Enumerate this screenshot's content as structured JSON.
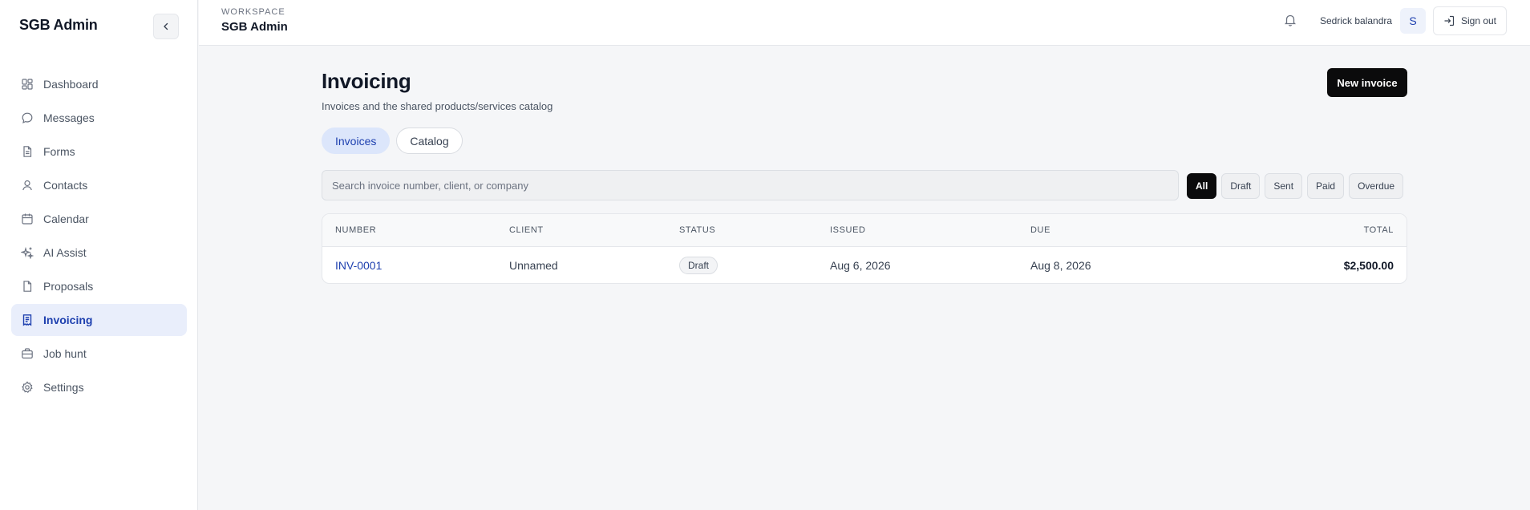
{
  "sidebar": {
    "brand": "SGB Admin",
    "items": [
      {
        "label": "Dashboard",
        "icon": "dashboard-icon"
      },
      {
        "label": "Messages",
        "icon": "message-icon"
      },
      {
        "label": "Forms",
        "icon": "document-icon"
      },
      {
        "label": "Contacts",
        "icon": "user-icon"
      },
      {
        "label": "Calendar",
        "icon": "calendar-icon"
      },
      {
        "label": "AI Assist",
        "icon": "sparkle-icon"
      },
      {
        "label": "Proposals",
        "icon": "document-icon"
      },
      {
        "label": "Invoicing",
        "icon": "receipt-icon",
        "active": true
      },
      {
        "label": "Job hunt",
        "icon": "briefcase-icon"
      },
      {
        "label": "Settings",
        "icon": "gear-icon"
      }
    ]
  },
  "header": {
    "workspace_label": "WORKSPACE",
    "workspace_name": "SGB Admin",
    "user_name": "Sedrick balandra",
    "avatar_initial": "S",
    "sign_out": "Sign out"
  },
  "main": {
    "title": "Invoicing",
    "subtitle": "Invoices and the shared products/services catalog",
    "new_invoice": "New invoice",
    "tabs": [
      {
        "label": "Invoices",
        "active": true
      },
      {
        "label": "Catalog",
        "active": false
      }
    ],
    "search": {
      "placeholder": "Search invoice number, client, or company",
      "value": ""
    },
    "filters": [
      {
        "label": "All",
        "active": true
      },
      {
        "label": "Draft"
      },
      {
        "label": "Sent"
      },
      {
        "label": "Paid"
      },
      {
        "label": "Overdue"
      }
    ],
    "table": {
      "columns": [
        "NUMBER",
        "CLIENT",
        "STATUS",
        "ISSUED",
        "DUE",
        "TOTAL"
      ],
      "rows": [
        {
          "number": "INV-0001",
          "client": "Unnamed",
          "status": "Draft",
          "issued": "Aug 6, 2026",
          "due": "Aug 8, 2026",
          "total": "$2,500.00"
        }
      ]
    }
  },
  "colors": {
    "accent": "#1e40af",
    "active_nav_bg": "#e9eefb",
    "primary_button": "#0b0b0c"
  }
}
